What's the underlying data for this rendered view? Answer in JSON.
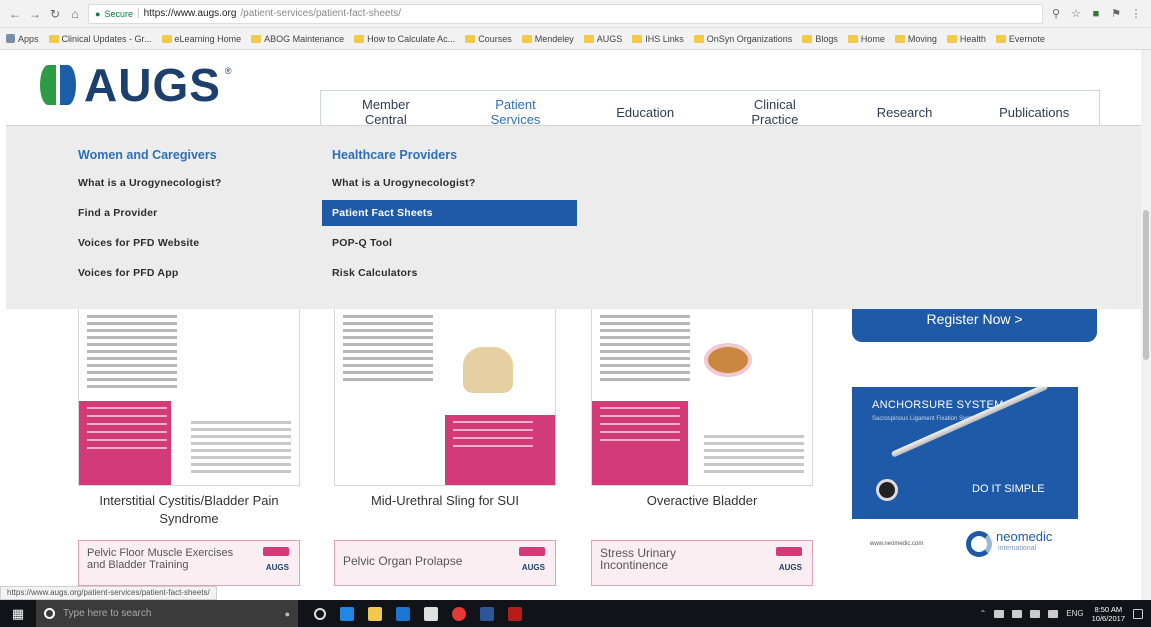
{
  "browser": {
    "url_host": "https://www.augs.org",
    "url_path": "/patient-services/patient-fact-sheets/",
    "secure_label": "Secure",
    "bookmarks": [
      "Apps",
      "Clinical Updates - Gr...",
      "eLearning Home",
      "ABOG Maintenance",
      "How to Calculate Ac...",
      "Courses",
      "Mendeley",
      "AUGS",
      "IHS Links",
      "OnSyn Organizations",
      "Blogs",
      "Home",
      "Moving",
      "Health",
      "Evernote"
    ]
  },
  "logo": {
    "text": "AUGS",
    "reg": "®"
  },
  "main_nav": [
    {
      "line1": "Member",
      "line2": "Central"
    },
    {
      "line1": "Patient",
      "line2": "Services"
    },
    {
      "line1": "Education",
      "line2": ""
    },
    {
      "line1": "Clinical",
      "line2": "Practice"
    },
    {
      "line1": "Research",
      "line2": ""
    },
    {
      "line1": "Publications",
      "line2": ""
    }
  ],
  "dropdown": {
    "col1": {
      "heading": "Women and Caregivers",
      "items": [
        "What is a Urogynecologist?",
        "Find a Provider",
        "Voices for PFD Website",
        "Voices for PFD App"
      ]
    },
    "col2": {
      "heading": "Healthcare Providers",
      "items": [
        "What is a Urogynecologist?",
        "Patient Fact Sheets",
        "POP-Q Tool",
        "Risk Calculators"
      ],
      "selected_index": 1
    }
  },
  "fact_sheets": [
    {
      "caption": "Interstitial Cystitis/Bladder Pain Syndrome"
    },
    {
      "caption": "Mid-Urethral Sling for SUI"
    },
    {
      "caption": "Overactive Bladder"
    }
  ],
  "thumbnails": [
    {
      "title": "Pelvic Floor Muscle Exercises and Bladder Training"
    },
    {
      "title": "Pelvic Organ Prolapse"
    },
    {
      "title": "Stress Urinary Incontinence"
    }
  ],
  "thumb_brand": "AUGS",
  "register_button": "Register Now >",
  "ad": {
    "title": "ANCHORSURE SYSTEM",
    "subtitle": "Sacrospinous Ligament Fixation System",
    "tagline": "DO IT SIMPLE",
    "website": "www.neomedic.com",
    "brand": "neomedic",
    "brand_sub": "international"
  },
  "status_url": "https://www.augs.org/patient-services/patient-fact-sheets/",
  "taskbar": {
    "search_placeholder": "Type here to search",
    "lang": "ENG",
    "time": "8:50 AM",
    "date": "10/6/2017"
  },
  "colors": {
    "brand_blue": "#1f5aa6",
    "link_blue": "#2f6fb7",
    "pink": "#d33a78",
    "dropdown_bg": "#ececec"
  }
}
